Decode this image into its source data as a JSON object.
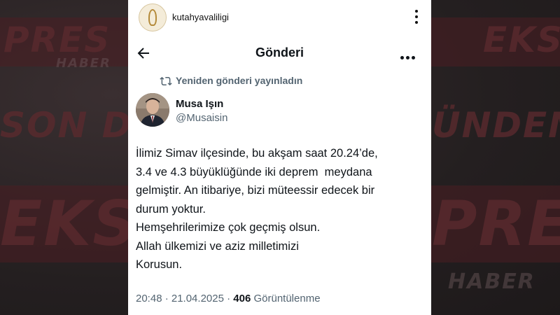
{
  "background": {
    "words": [
      "PRES",
      "HABER",
      "SON D",
      "EKS",
      "ÜNDEM",
      "EKS",
      "EKS",
      "PRES",
      "HABER"
    ]
  },
  "instagram": {
    "username": "kutahyavaliligi",
    "more_icon": "vertical-ellipsis-icon"
  },
  "x_post": {
    "header_title": "Gönderi",
    "back_icon": "arrow-left-icon",
    "more_icon": "horizontal-ellipsis-icon",
    "repost_label": "Yeniden gönderi yayınladın",
    "repost_icon": "repost-icon",
    "author": {
      "name": "Musa Işın",
      "handle": "@Musaisin"
    },
    "text_lines": [
      "İlimiz Simav ilçesinde, bu akşam saat 20.24’de,",
      "3.4 ve 4.3 büyüklüğünde iki deprem  meydana",
      "gelmiştir. An itibariye, bizi müteessir edecek bir",
      "durum yoktur.",
      "Hemşehrilerimize çok geçmiş olsun.",
      "Allah ülkemizi ve aziz milletimizi",
      "Korusun."
    ],
    "timestamp": "20:48 · 21.04.2025 · ",
    "views_count": "406",
    "views_label": " Görüntülenme"
  },
  "colors": {
    "text_primary": "#0f1419",
    "text_secondary": "#536471",
    "background_red": "#5a2a2e"
  }
}
